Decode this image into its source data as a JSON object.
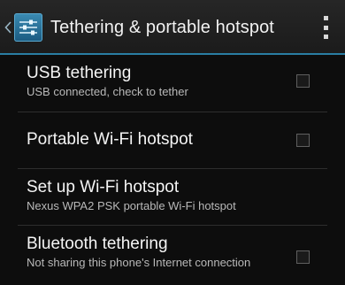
{
  "action_bar": {
    "title": "Tethering & portable hotspot",
    "up_icon": "chevron-left-icon",
    "app_icon": "settings-sliders-icon",
    "overflow_icon": "overflow-menu-icon",
    "accent_color": "#2a7ea3"
  },
  "settings": [
    {
      "title": "USB tethering",
      "summary": "USB connected, check to tether",
      "checked": false
    },
    {
      "title": "Portable Wi-Fi hotspot",
      "summary": "",
      "checked": false
    },
    {
      "title": "Set up Wi-Fi hotspot",
      "summary": "Nexus WPA2 PSK portable Wi-Fi hotspot"
    },
    {
      "title": "Bluetooth tethering",
      "summary": "Not sharing this phone's Internet connection",
      "checked": false
    }
  ]
}
